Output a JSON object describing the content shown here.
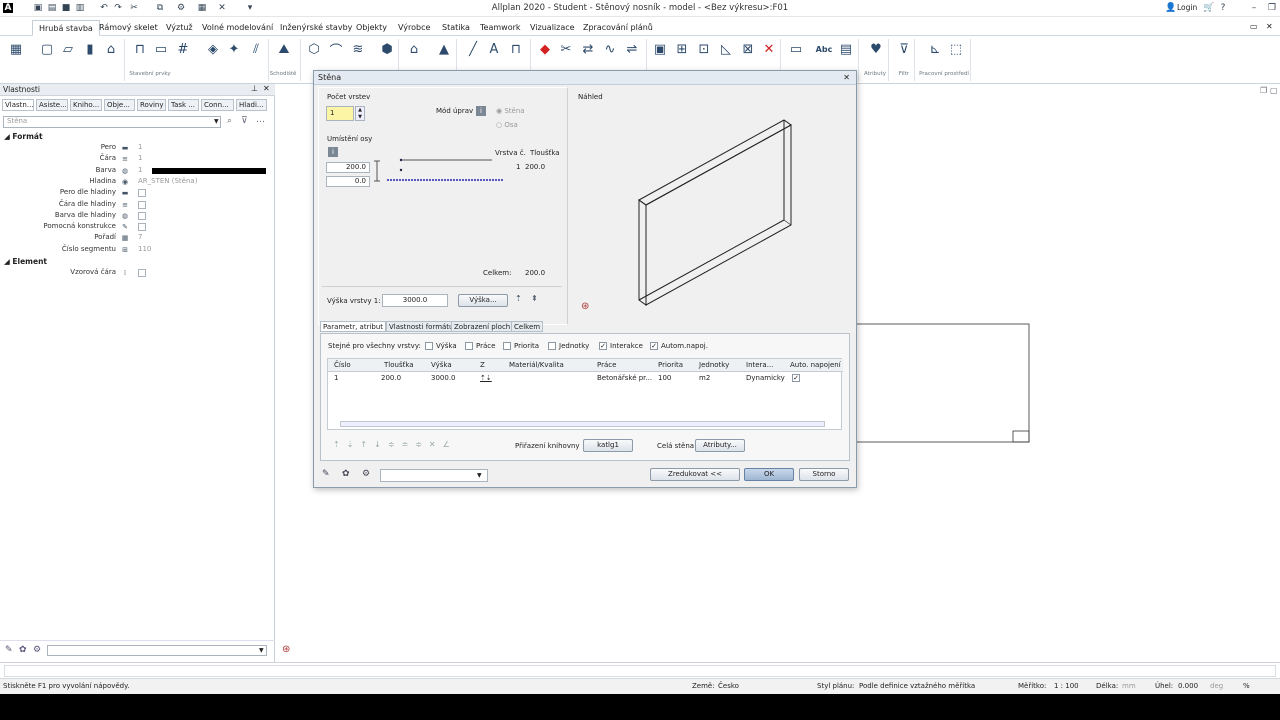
{
  "app": {
    "title": "Allplan 2020 - Student - Stěnový nosník - model - <Bez výkresu>:F01",
    "login_label": "Login"
  },
  "ribbon_tabs": [
    {
      "label": "Hrubá stavba",
      "active": true
    },
    {
      "label": "Rámový skelet"
    },
    {
      "label": "Výztuž"
    },
    {
      "label": "Volné modelování"
    },
    {
      "label": "Inženýrské stavby"
    },
    {
      "label": "Objekty"
    },
    {
      "label": "Výrobce"
    },
    {
      "label": "Statika"
    },
    {
      "label": "Teamwork"
    },
    {
      "label": "Vizualizace"
    },
    {
      "label": "Zpracování plánů"
    }
  ],
  "ribbon_groups": {
    "g1": "Stavební prvky",
    "g2": "Schodiště",
    "g3": "Atributy",
    "g4": "Filtr",
    "g5": "Pracovní prostředí"
  },
  "ribbon_text_tool": "Abc",
  "panel": {
    "title": "Vlastnosti",
    "tabs": [
      "Vlastn...",
      "Asiste...",
      "Kniho...",
      "Obje...",
      "Roviny",
      "Task ...",
      "Conn...",
      "Hladi..."
    ],
    "filter_value": "Stěna",
    "section_format": "Formát",
    "section_element": "Element",
    "rows": [
      {
        "label": "Pero",
        "value": "1"
      },
      {
        "label": "Čára",
        "value": "1"
      },
      {
        "label": "Barva",
        "value": "1"
      },
      {
        "label": "Hladina",
        "value": "AR_STEN (Stěna)"
      },
      {
        "label": "Pero dle hladiny",
        "value": ""
      },
      {
        "label": "Čára dle hladiny",
        "value": ""
      },
      {
        "label": "Barva dle hladiny",
        "value": ""
      },
      {
        "label": "Pomocná konstrukce",
        "value": ""
      },
      {
        "label": "Pořadí",
        "value": "7"
      },
      {
        "label": "Číslo segmentu",
        "value": "110"
      }
    ],
    "element_row": {
      "label": "Vzorová čára",
      "value": ""
    }
  },
  "dialog": {
    "title": "Stěna",
    "pocet_vrstev_label": "Počet vrstev",
    "pocet_vrstev_value": "1",
    "mod_uprav_label": "Mód úprav",
    "mod_opt1": "Stěna",
    "mod_opt2": "Osa",
    "umisteni_osy_label": "Umístění osy",
    "osa_val1": "200.0",
    "osa_val2": "0.0",
    "vrstva_c": "Vrstva č.",
    "tloustka": "Tloušťka",
    "layer_no": "1",
    "layer_th": "200.0",
    "celkem_label": "Celkem:",
    "celkem_value": "200.0",
    "vyska_label": "Výška vrstvy 1:",
    "vyska_value": "3000.0",
    "vyska_btn": "Výška...",
    "nahled_label": "Náhled",
    "tabs": [
      "Parametr, atribut",
      "Vlastnosti formátu",
      "Zobrazení ploch",
      "Celkem"
    ],
    "same_label": "Stejné pro všechny vrstvy:",
    "checks": [
      {
        "label": "Výška",
        "checked": false
      },
      {
        "label": "Práce",
        "checked": false
      },
      {
        "label": "Priorita",
        "checked": false
      },
      {
        "label": "Jednotky",
        "checked": false
      },
      {
        "label": "Interakce",
        "checked": true
      },
      {
        "label": "Autom.napoj.",
        "checked": true
      }
    ],
    "table_headers": [
      "Číslo",
      "Tloušťka",
      "Výška",
      "Z",
      "Materiál/Kvalita",
      "Práce",
      "Priorita",
      "Jednotky",
      "Intera...",
      "Auto. napojení"
    ],
    "table_row": [
      "1",
      "200.0",
      "3000.0",
      "",
      "",
      "Betonářské pr...",
      "100",
      "m2",
      "Dynamicky",
      ""
    ],
    "prirazeni_label": "Přiřazení knihovny",
    "katlg_btn": "katlg1",
    "cela_stena_label": "Celá stěna",
    "atributy_btn": "Atributy...",
    "zredukovat_btn": "Zredukovat <<",
    "ok_btn": "OK",
    "storno_btn": "Storno"
  },
  "status": {
    "help": "Stiskněte F1 pro vyvolání nápovědy.",
    "zeme_label": "Země:",
    "zeme_value": "Česko",
    "styl_label": "Styl plánu:",
    "styl_value": "Podle definice vztažného měřítka",
    "meritko_label": "Měřítko:",
    "meritko_value": "1 : 100",
    "delka_label": "Délka:",
    "delka_value": "mm",
    "uhel_label": "Úhel:",
    "uhel_value": "0.000",
    "uhel_unit": "deg",
    "pct": "%"
  }
}
